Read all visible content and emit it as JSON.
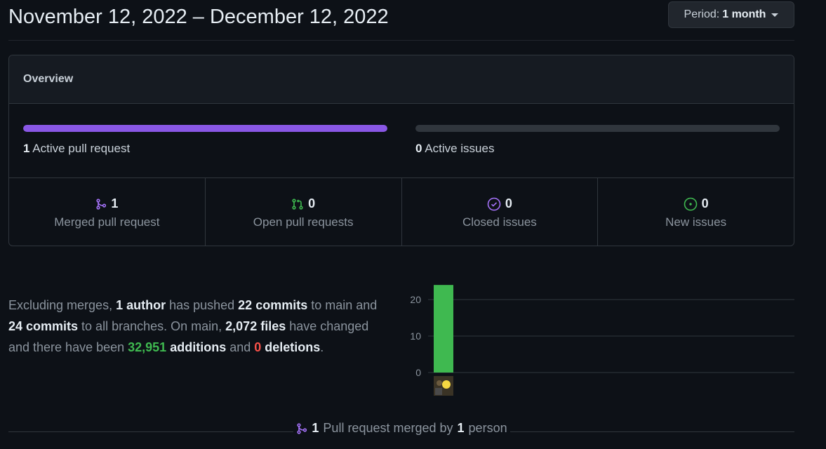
{
  "header": {
    "date_range": "November 12, 2022 – December 12, 2022",
    "period_label": "Period:",
    "period_value": "1 month"
  },
  "overview": {
    "title": "Overview",
    "pull_requests": {
      "count": "1",
      "label": "Active pull request",
      "fill_fraction": 1.0,
      "color": "#8957e5"
    },
    "issues": {
      "count": "0",
      "label": "Active issues",
      "fill_fraction": 0.0,
      "color": "#30363d"
    },
    "stats": [
      {
        "icon": "git-merge-icon",
        "count": "1",
        "label": "Merged pull request",
        "color": "#a371f7"
      },
      {
        "icon": "git-pull-request-icon",
        "count": "0",
        "label": "Open pull requests",
        "color": "#3fb950"
      },
      {
        "icon": "issue-closed-icon",
        "count": "0",
        "label": "Closed issues",
        "color": "#a371f7"
      },
      {
        "icon": "issue-opened-icon",
        "count": "0",
        "label": "New issues",
        "color": "#3fb950"
      }
    ]
  },
  "summary": {
    "t1": "Excluding merges, ",
    "authors": "1 author",
    "t2": " has pushed ",
    "commits_main": "22 commits",
    "t3": " to main and ",
    "commits_all": "24 commits",
    "t4": " to all branches. On main, ",
    "files": "2,072 files",
    "t5": " have changed and there have been ",
    "additions_num": "32,951",
    "additions_word": " additions",
    "t6": " and ",
    "deletions_num": "0",
    "deletions_word": " deletions",
    "t7": "."
  },
  "chart_data": {
    "type": "bar",
    "categories": [
      "author avatar"
    ],
    "values": [
      24
    ],
    "ylim": [
      0,
      24
    ],
    "yticks": [
      "0",
      "10",
      "20"
    ],
    "bar_color": "#3fb950",
    "grid": true
  },
  "footer": {
    "prefix": "1",
    "middle": "Pull request merged by",
    "count": "1",
    "suffix": "person"
  }
}
